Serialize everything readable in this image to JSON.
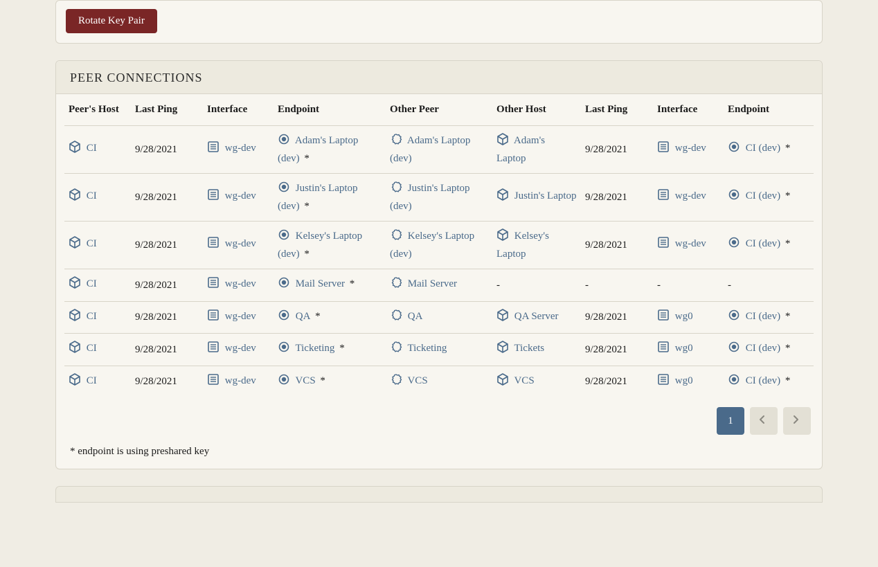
{
  "rotate_button_label": "Rotate Key Pair",
  "section_title": "PEER CONNECTIONS",
  "columns": [
    "Peer's Host",
    "Last Ping",
    "Interface",
    "Endpoint",
    "Other Peer",
    "Other Host",
    "Last Ping",
    "Interface",
    "Endpoint"
  ],
  "rows": [
    {
      "peer_host": "CI",
      "last_ping": "9/28/2021",
      "iface": "wg-dev",
      "endpoint": "Adam's Laptop (dev)",
      "endpoint_psk": "*",
      "other_peer": "Adam's Laptop (dev)",
      "other_host": "Adam's Laptop",
      "last_ping2": "9/28/2021",
      "iface2": "wg-dev",
      "endpoint2": "CI (dev)",
      "endpoint2_psk": "*"
    },
    {
      "peer_host": "CI",
      "last_ping": "9/28/2021",
      "iface": "wg-dev",
      "endpoint": "Justin's Laptop (dev)",
      "endpoint_psk": "*",
      "other_peer": "Justin's Laptop (dev)",
      "other_host": "Justin's Laptop",
      "last_ping2": "9/28/2021",
      "iface2": "wg-dev",
      "endpoint2": "CI (dev)",
      "endpoint2_psk": "*"
    },
    {
      "peer_host": "CI",
      "last_ping": "9/28/2021",
      "iface": "wg-dev",
      "endpoint": "Kelsey's Laptop (dev)",
      "endpoint_psk": "*",
      "other_peer": "Kelsey's Laptop (dev)",
      "other_host": "Kelsey's Laptop",
      "last_ping2": "9/28/2021",
      "iface2": "wg-dev",
      "endpoint2": "CI (dev)",
      "endpoint2_psk": "*"
    },
    {
      "peer_host": "CI",
      "last_ping": "9/28/2021",
      "iface": "wg-dev",
      "endpoint": "Mail Server",
      "endpoint_psk": "*",
      "other_peer": "Mail Server",
      "other_host": "-",
      "last_ping2": "-",
      "iface2": "-",
      "endpoint2": "-",
      "endpoint2_psk": ""
    },
    {
      "peer_host": "CI",
      "last_ping": "9/28/2021",
      "iface": "wg-dev",
      "endpoint": "QA",
      "endpoint_psk": "*",
      "other_peer": "QA",
      "other_host": "QA Server",
      "last_ping2": "9/28/2021",
      "iface2": "wg0",
      "endpoint2": "CI (dev)",
      "endpoint2_psk": "*"
    },
    {
      "peer_host": "CI",
      "last_ping": "9/28/2021",
      "iface": "wg-dev",
      "endpoint": "Ticketing",
      "endpoint_psk": "*",
      "other_peer": "Ticketing",
      "other_host": "Tickets",
      "last_ping2": "9/28/2021",
      "iface2": "wg0",
      "endpoint2": "CI (dev)",
      "endpoint2_psk": "*"
    },
    {
      "peer_host": "CI",
      "last_ping": "9/28/2021",
      "iface": "wg-dev",
      "endpoint": "VCS",
      "endpoint_psk": "*",
      "other_peer": "VCS",
      "other_host": "VCS",
      "last_ping2": "9/28/2021",
      "iface2": "wg0",
      "endpoint2": "CI (dev)",
      "endpoint2_psk": "*"
    }
  ],
  "footnote": "* endpoint is using preshared key",
  "pagination": {
    "current": "1"
  },
  "icons": {
    "cube": "cube-icon",
    "board": "board-icon",
    "dot": "record-dot-icon",
    "badge": "badge-icon"
  },
  "colors": {
    "link": "#4a6a8a",
    "primary_button": "#7a2626"
  }
}
